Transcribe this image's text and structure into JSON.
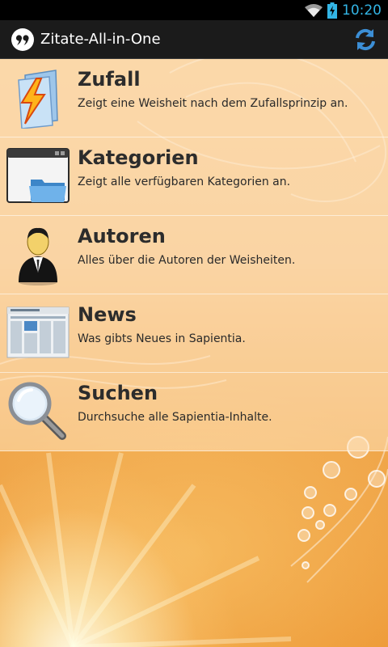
{
  "status_bar": {
    "time": "10:20",
    "icons": [
      "wifi-icon",
      "battery-charging-icon"
    ]
  },
  "action_bar": {
    "title": "Zitate-All-in-One",
    "logo_icon": "quote-icon",
    "refresh_icon": "refresh-icon"
  },
  "menu": {
    "items": [
      {
        "title": "Zufall",
        "description": "Zeigt eine Weisheit nach dem Zufallsprinzip an.",
        "icon": "lightning-folder-icon"
      },
      {
        "title": "Kategorien",
        "description": "Zeigt alle verfügbaren Kategorien an.",
        "icon": "window-folder-icon"
      },
      {
        "title": "Autoren",
        "description": "Alles über die Autoren der Weisheiten.",
        "icon": "person-icon"
      },
      {
        "title": "News",
        "description": "Was gibts Neues in Sapientia.",
        "icon": "newspaper-icon"
      },
      {
        "title": "Suchen",
        "description": "Durchsuche alle Sapientia-Inhalte.",
        "icon": "magnifier-icon"
      }
    ]
  },
  "colors": {
    "status_time": "#33b5e5",
    "action_bar": "#1b1b1b",
    "background": "#f0a040"
  }
}
